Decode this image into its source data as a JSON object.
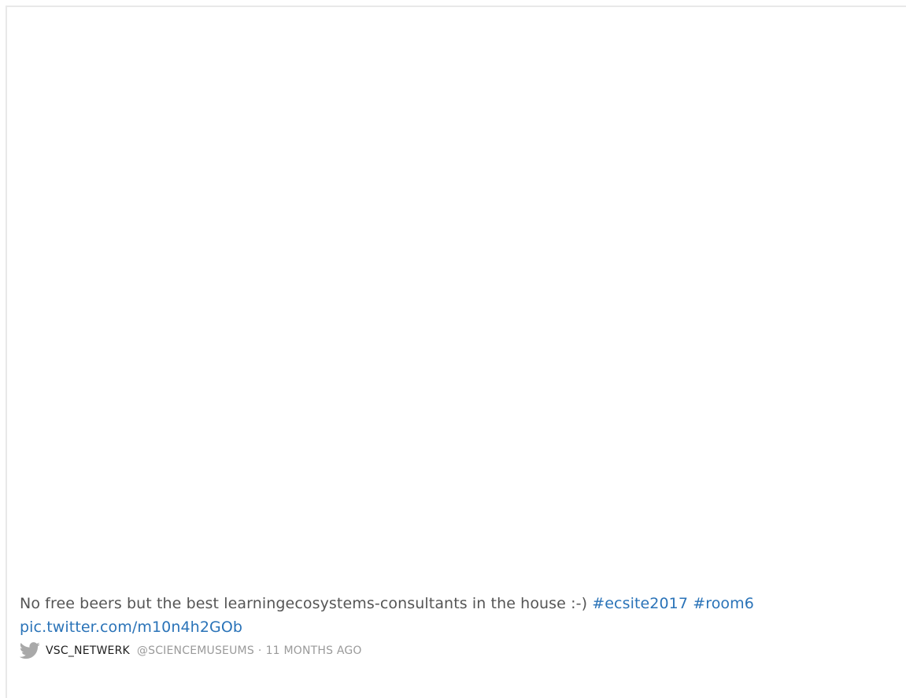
{
  "tweet": {
    "text": "No free beers but the best learningecosystems-consultants in the house :-) ",
    "hashtags": [
      "#ecsite2017",
      "#room6"
    ],
    "link": "pic.twitter.com/m10n4h2GOb"
  },
  "meta": {
    "icon": "twitter-bird-icon",
    "username": "VSC_NETWERK",
    "handle": "@SCIENCEMUSEUMS",
    "separator": "·",
    "time": "11 MONTHS AGO"
  },
  "colors": {
    "link": "#2a73b8",
    "text": "#555555",
    "muted": "#9a9a9a",
    "bird": "#a9a9a9"
  }
}
